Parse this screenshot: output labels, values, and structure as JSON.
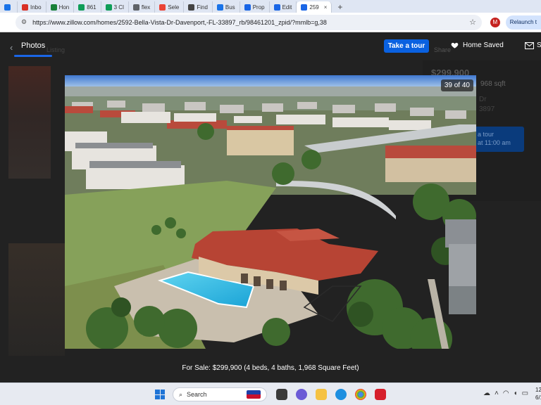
{
  "browser": {
    "tabs": [
      {
        "label": "",
        "color": "#1a73e8"
      },
      {
        "label": "Inbo",
        "color": "#d93025"
      },
      {
        "label": "Hon",
        "color": "#188038"
      },
      {
        "label": "861",
        "color": "#0f9d58"
      },
      {
        "label": "3 Cl",
        "color": "#0f9d58"
      },
      {
        "label": "flex",
        "color": "#5f6368"
      },
      {
        "label": "Sele",
        "color": "#ea4335"
      },
      {
        "label": "Find",
        "color": "#444444"
      },
      {
        "label": "Bus",
        "color": "#1a73e8"
      },
      {
        "label": "Prop",
        "color": "#1a66e6"
      },
      {
        "label": "Edit",
        "color": "#1a66e6"
      },
      {
        "label": "259",
        "color": "#1a66e6",
        "active": true
      }
    ],
    "new_tab": "+",
    "url": "https://www.zillow.com/homes/2592-Bella-Vista-Dr-Davenport,-FL-33897_rb/98461201_zpid/?mmlb=g,38",
    "profile_initial": "M",
    "relaunch_label": "Relaunch t"
  },
  "header": {
    "photos_tab": "Photos",
    "listing_faded": "Listing",
    "tour_button": "Take a tour",
    "share_faded": "Share",
    "saved_label": "Home Saved",
    "mail_label": "S"
  },
  "background": {
    "price": "$299,900",
    "sqft": "968 sqft",
    "addr1": "Dr",
    "addr2": "3897",
    "tour_btn": "a tour",
    "tour_sub": "at 11:00 am"
  },
  "photo": {
    "counter": "39 of 40",
    "caption": "For Sale: $299,900 (4 beds, 4 baths, 1,968 Square Feet)"
  },
  "taskbar": {
    "search_label": "Search",
    "clock_time": "12",
    "clock_date": "6/1"
  },
  "colors": {
    "accent": "#0a61e0",
    "page_bg": "#222222"
  }
}
